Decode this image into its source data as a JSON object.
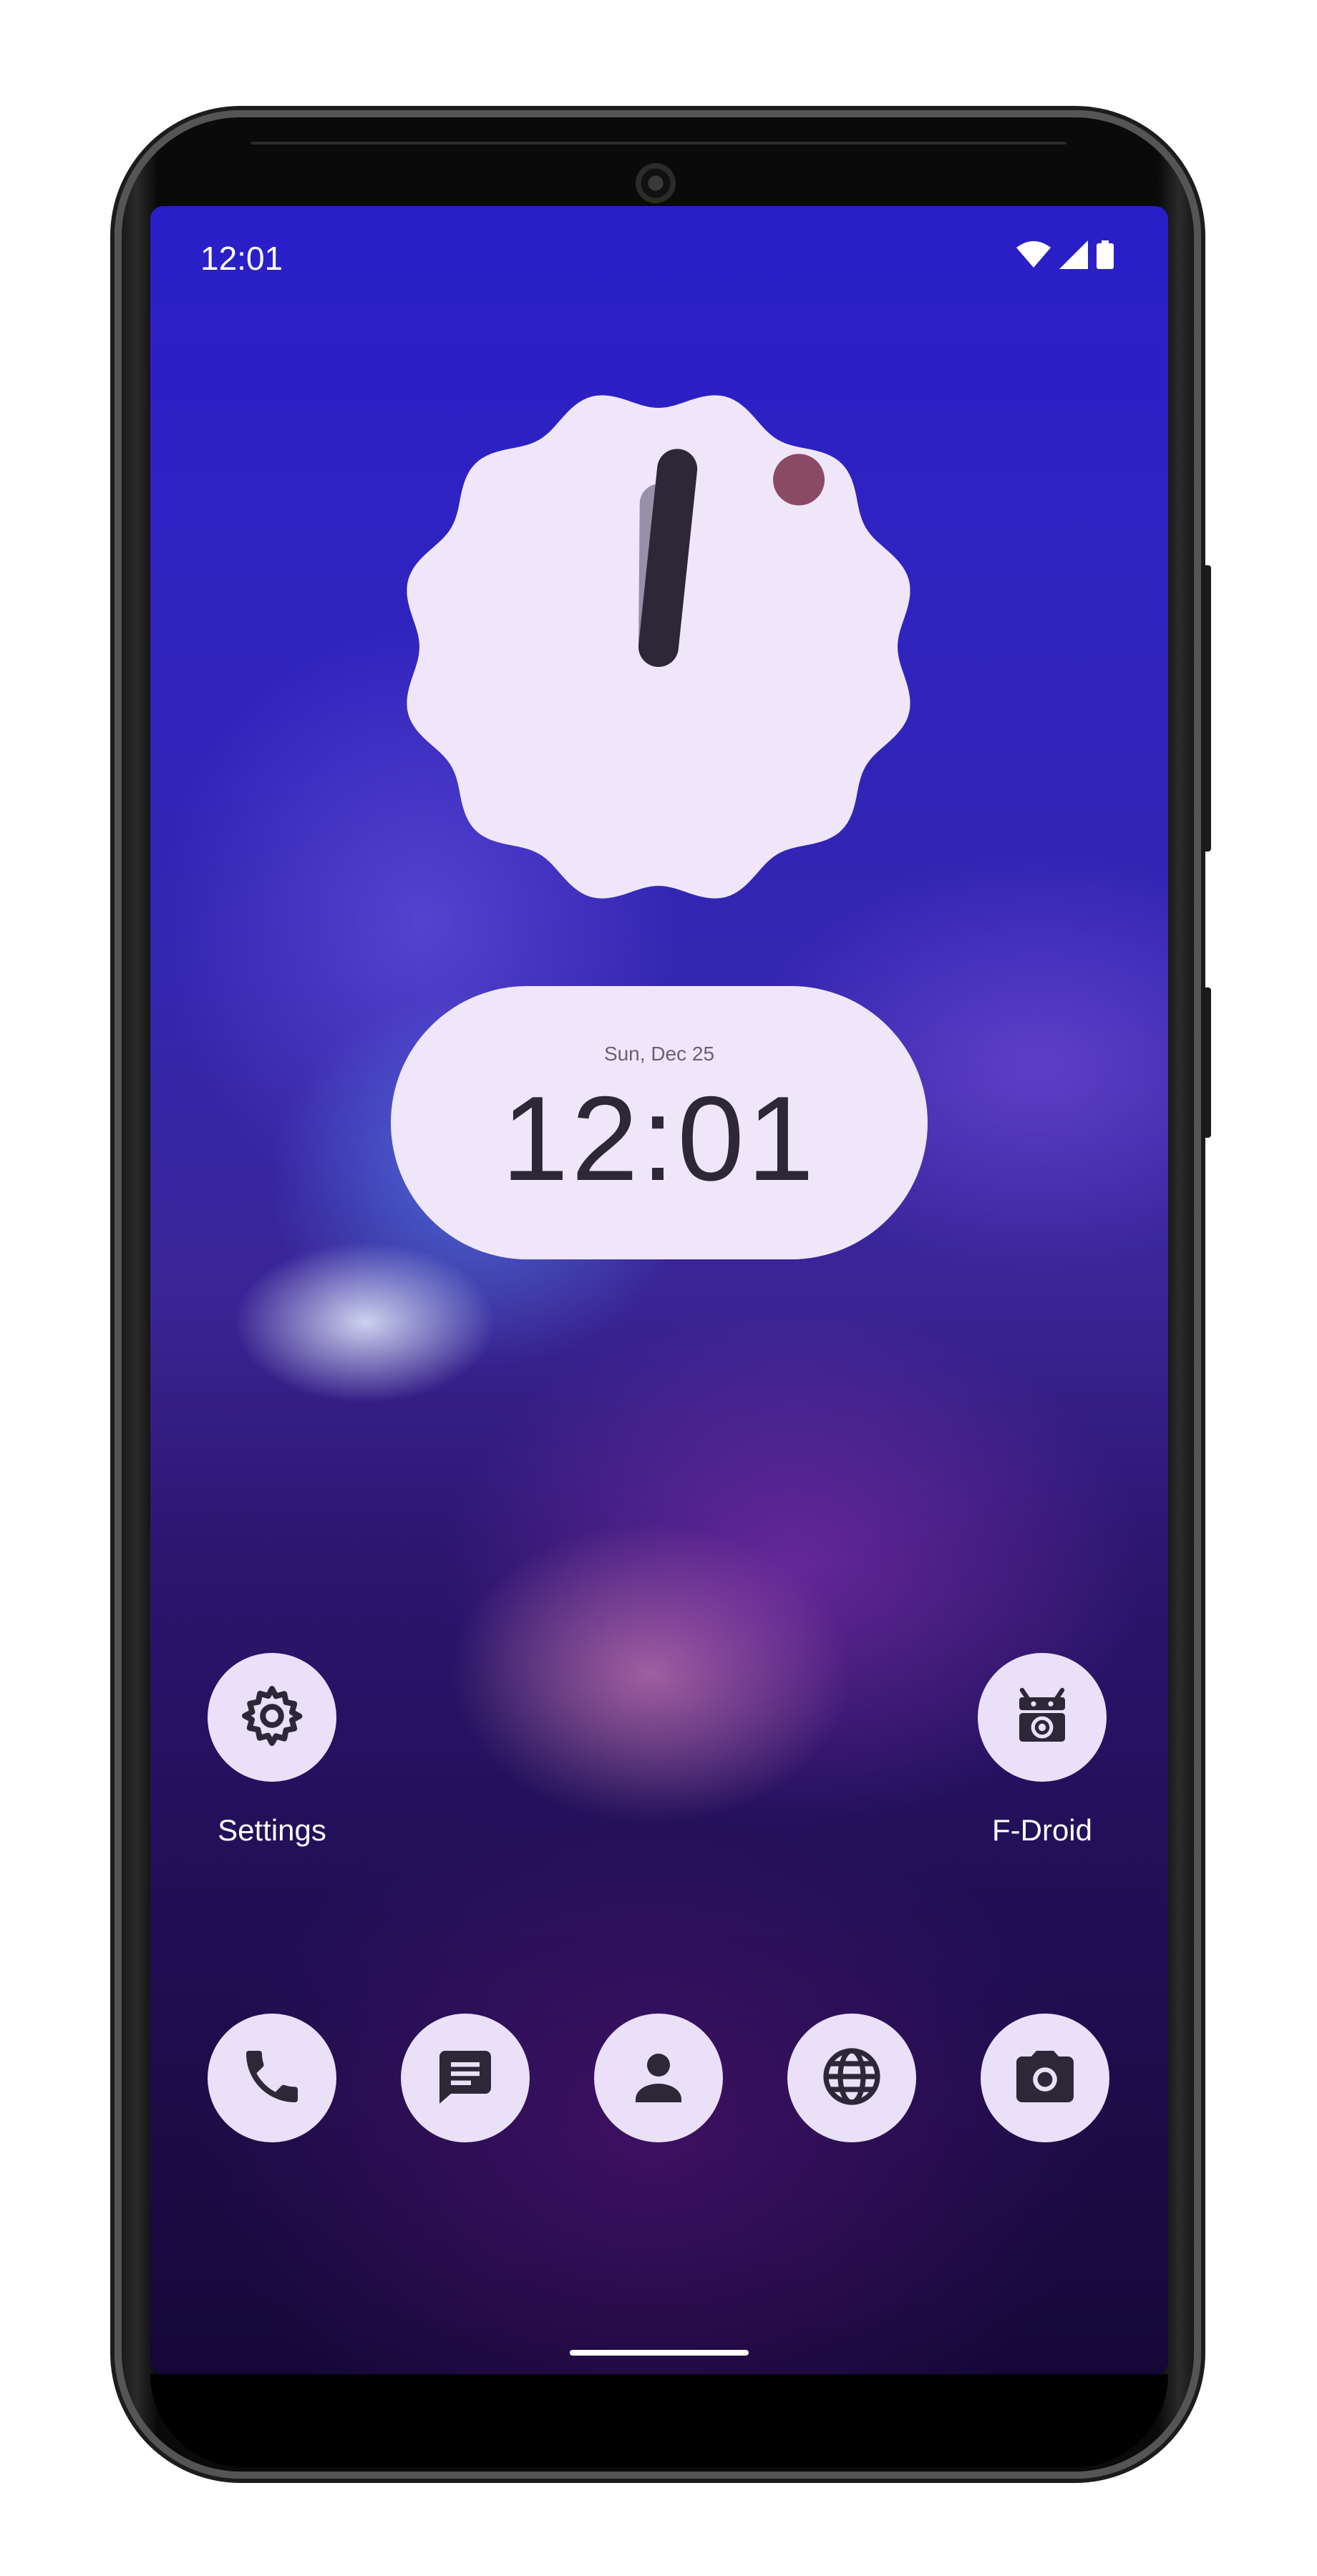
{
  "status_bar": {
    "time": "12:01",
    "icons": [
      "wifi-icon",
      "cellular-signal-icon",
      "battery-icon"
    ]
  },
  "clock_widget": {
    "date": "Sun, Dec 25",
    "time": "12:01"
  },
  "home_apps": [
    {
      "name": "Settings",
      "icon": "gear-icon"
    },
    {
      "name": "F-Droid",
      "icon": "fdroid-icon"
    }
  ],
  "dock_apps": [
    {
      "icon": "phone-icon"
    },
    {
      "icon": "messages-icon"
    },
    {
      "icon": "contacts-icon"
    },
    {
      "icon": "browser-icon"
    },
    {
      "icon": "camera-icon"
    }
  ],
  "colors": {
    "widget_bg": "#efe6fa",
    "icon_bg": "#eae0f8",
    "icon_fg": "#2d2838",
    "second_dot": "#8b4a64"
  }
}
